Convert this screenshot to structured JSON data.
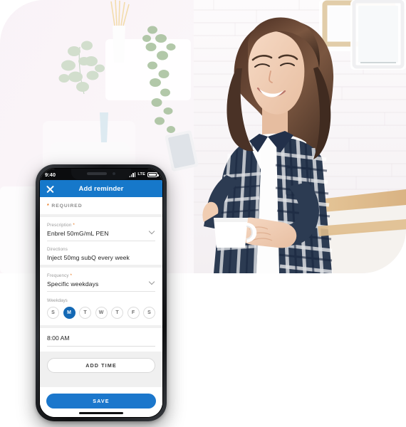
{
  "hero": {
    "alt": "Smiling woman in navy plaid shirt holding a smartphone and white coffee mug in a bright white kitchen",
    "scene": "bright-white-kitchen"
  },
  "phone": {
    "status_bar": {
      "time": "9:40",
      "network_label": "LTE",
      "signal_icon": "signal-bars-icon",
      "battery_icon": "battery-icon"
    },
    "app_bar": {
      "close_icon": "close-icon",
      "title": "Add reminder",
      "background": "#1678CA"
    },
    "required_note": {
      "star": "*",
      "label": "REQUIRED",
      "star_color": "#E8761A"
    },
    "fields": [
      {
        "label": "Prescription",
        "required": true,
        "value": "Enbrel 50mG/mL PEN",
        "has_chevron": true
      },
      {
        "label": "Directions",
        "required": false,
        "value": "Inject 50mg subQ every week",
        "has_chevron": false
      },
      {
        "label": "Frequency",
        "required": true,
        "value": "Specific weekdays",
        "has_chevron": true
      }
    ],
    "weekdays": {
      "label": "Weekdays",
      "days": [
        {
          "letter": "S",
          "selected": false
        },
        {
          "letter": "M",
          "selected": true
        },
        {
          "letter": "T",
          "selected": false
        },
        {
          "letter": "W",
          "selected": false
        },
        {
          "letter": "T",
          "selected": false
        },
        {
          "letter": "F",
          "selected": false
        },
        {
          "letter": "S",
          "selected": false
        }
      ],
      "selected_color": "#1469B5"
    },
    "time_value": "8:00 AM",
    "add_time_label": "ADD TIME",
    "save_label": "SAVE",
    "save_color": "#1B77CC"
  }
}
